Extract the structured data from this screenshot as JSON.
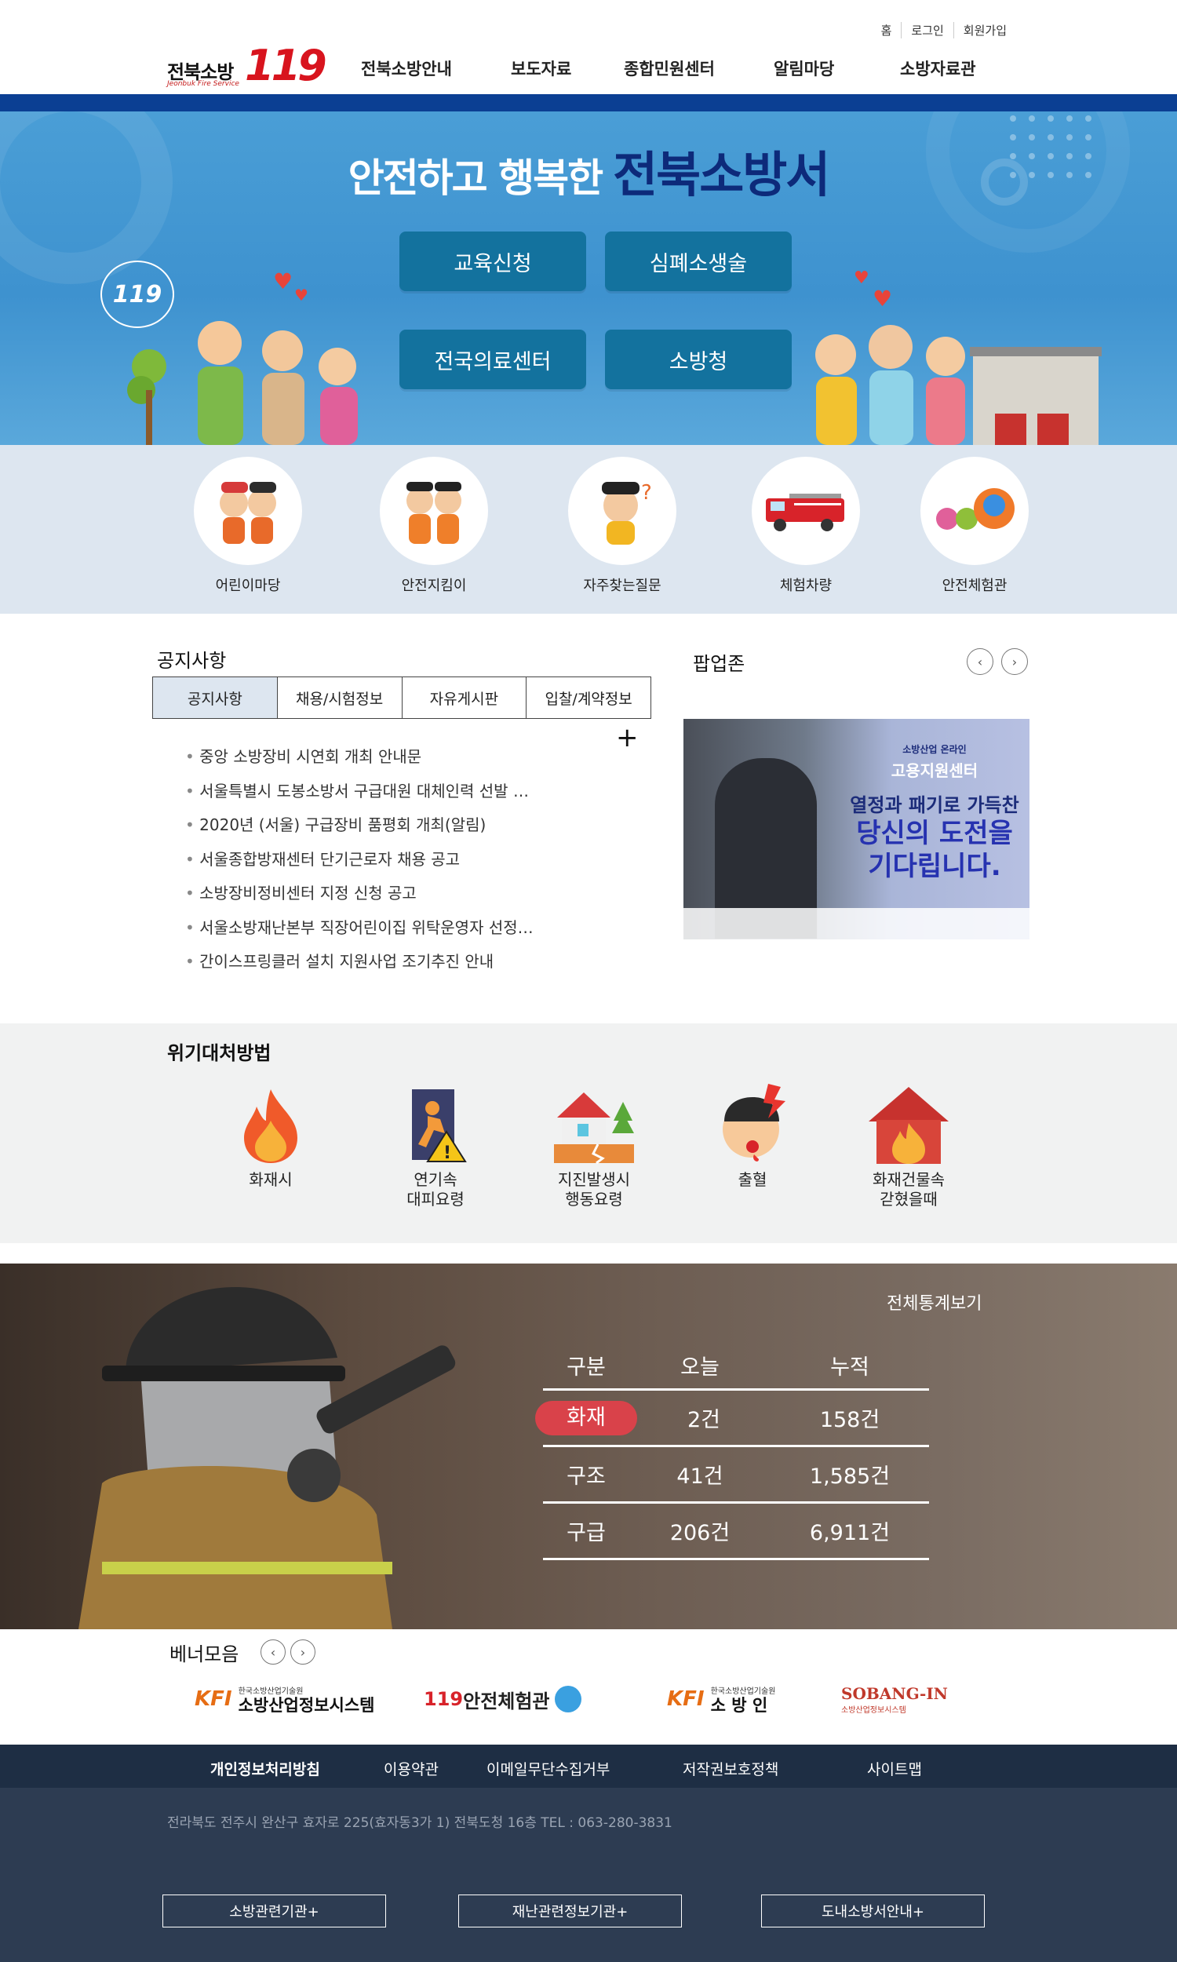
{
  "header": {
    "util_links": [
      "홈",
      "로그인",
      "회원가입"
    ],
    "logo": {
      "korean": "전북소방",
      "english": "Jeonbuk Fire Service",
      "number": "119"
    },
    "menu": [
      "전북소방안내",
      "보도자료",
      "종합민원센터",
      "알림마당",
      "소방자료관"
    ]
  },
  "hero": {
    "title_part1": "안전하고 행복한",
    "title_part2": "전북소방서",
    "bubble": "119",
    "buttons": [
      "교육신청",
      "심폐소생술",
      "전국의료센터",
      "소방청"
    ]
  },
  "quick_menu": [
    {
      "label": "어린이마당",
      "icon": "kids-firefighter-icon"
    },
    {
      "label": "안전지킴이",
      "icon": "safety-guard-icon"
    },
    {
      "label": "자주찾는질문",
      "icon": "faq-character-icon"
    },
    {
      "label": "체험차량",
      "icon": "fire-truck-icon"
    },
    {
      "label": "안전체험관",
      "icon": "experience-hall-icon"
    }
  ],
  "notice": {
    "title": "공지사항",
    "tabs": [
      "공지사항",
      "채용/시험정보",
      "자유게시판",
      "입찰/계약정보"
    ],
    "more": "+",
    "items": [
      "중앙 소방장비 시연회 개최 안내문",
      "서울특별시 도봉소방서 구급대원 대체인력 선발 …",
      "2020년 (서울) 구급장비 품평회 개최(알림)",
      "서울종합방재센터 단기근로자 채용 공고",
      "소방장비정비센터 지정 신청 공고",
      "서울소방재난본부 직장어린이집 위탁운영자 선정…",
      "간이스프링클러 설치 지원사업 조기추진 안내"
    ]
  },
  "popup": {
    "title": "팝업존",
    "banner_line0": "소방산업 온라인",
    "banner_line1": "고용지원센터",
    "banner_line2": "열정과 패기로 가득찬",
    "banner_line3": "당신의 도전을 기다립니다."
  },
  "crisis": {
    "title": "위기대처방법",
    "items": [
      {
        "label": "화재시",
        "icon": "flame-icon"
      },
      {
        "label": "연기속\n대피요령",
        "icon": "emergency-exit-icon"
      },
      {
        "label": "지진발생시\n행동요령",
        "icon": "earthquake-house-icon"
      },
      {
        "label": "출혈",
        "icon": "bleeding-face-icon"
      },
      {
        "label": "화재건물속\n갇혔을때",
        "icon": "burning-house-icon"
      }
    ]
  },
  "stats": {
    "link": "전체통계보기",
    "headers": [
      "구분",
      "오늘",
      "누적"
    ],
    "rows": [
      {
        "type": "화재",
        "today": "2건",
        "total": "158건",
        "highlight": true
      },
      {
        "type": "구조",
        "today": "41건",
        "total": "1,585건",
        "highlight": false
      },
      {
        "type": "구급",
        "today": "206건",
        "total": "6,911건",
        "highlight": false
      }
    ]
  },
  "banners": {
    "title": "베너모음",
    "items": [
      {
        "kind": "kfi",
        "mark": "KFI",
        "small": "한국소방산업기술원",
        "big": "소방산업정보시스템"
      },
      {
        "kind": "text",
        "red": "119",
        "rest": "안전체험관"
      },
      {
        "kind": "kfi",
        "mark": "KFI",
        "small": "한국소방산업기술원",
        "big": "소 방 인"
      },
      {
        "kind": "sobang",
        "big": "SOBANG-IN",
        "small": "소방산업정보시스템"
      }
    ]
  },
  "footer": {
    "nav": [
      "개인정보처리방침",
      "이용약관",
      "이메일무단수집거부",
      "저작권보호정책",
      "사이트맵"
    ],
    "address": "전라북도 전주시 완산구 효자로 225(효자동3가 1) 전북도청  16층 TEL : 063-280-3831",
    "buttons": [
      "소방관련기관+",
      "재난관련정보기관+",
      "도내소방서안내+"
    ]
  },
  "colors": {
    "primary_navy": "#0b3f93",
    "hero_blue": "#3e92cf",
    "button_teal": "#13729e",
    "highlight_red": "#d9424a",
    "footer_dark": "#2d3c52"
  }
}
